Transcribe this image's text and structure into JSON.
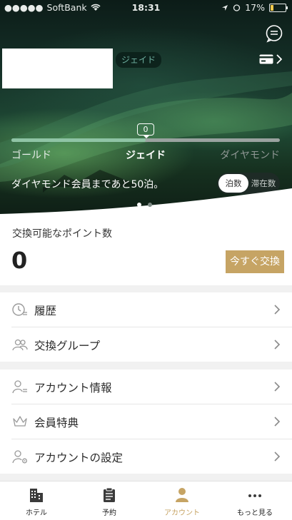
{
  "status_bar": {
    "carrier": "SoftBank",
    "time": "18:31",
    "battery": "17%"
  },
  "header": {
    "tier_chip": "ジェイド"
  },
  "progress": {
    "count": "0",
    "fill_fraction": 0.5,
    "tiers": [
      "ゴールド",
      "ジェイド",
      "ダイヤモンド"
    ],
    "message": "ダイヤモンド会員まであと50泊。",
    "toggle": {
      "active": "泊数",
      "inactive": "滞在数"
    },
    "page_dots": {
      "total": 2,
      "active_index": 0
    }
  },
  "points": {
    "label": "交換可能なポイント数",
    "value": "0",
    "button_label": "今すぐ交換"
  },
  "menu": [
    {
      "label": "履歴",
      "icon": "history-clock-icon"
    },
    {
      "label": "交換グループ",
      "icon": "group-people-icon"
    },
    {
      "label": "アカウント情報",
      "icon": "account-info-icon"
    },
    {
      "label": "会員特典",
      "icon": "crown-icon"
    },
    {
      "label": "アカウントの設定",
      "icon": "account-settings-icon"
    }
  ],
  "tabbar": {
    "tabs": [
      {
        "label": "ホテル",
        "icon": "hotel-building-icon"
      },
      {
        "label": "予約",
        "icon": "reservation-clipboard-icon"
      },
      {
        "label": "アカウント",
        "icon": "account-person-icon",
        "active": true
      },
      {
        "label": "もっと見る",
        "icon": "more-dots-icon"
      }
    ]
  },
  "colors": {
    "accent_gold": "#c6a464",
    "progress_green": "#8fc4a5",
    "tier_chip_text": "#6fb0a0"
  }
}
